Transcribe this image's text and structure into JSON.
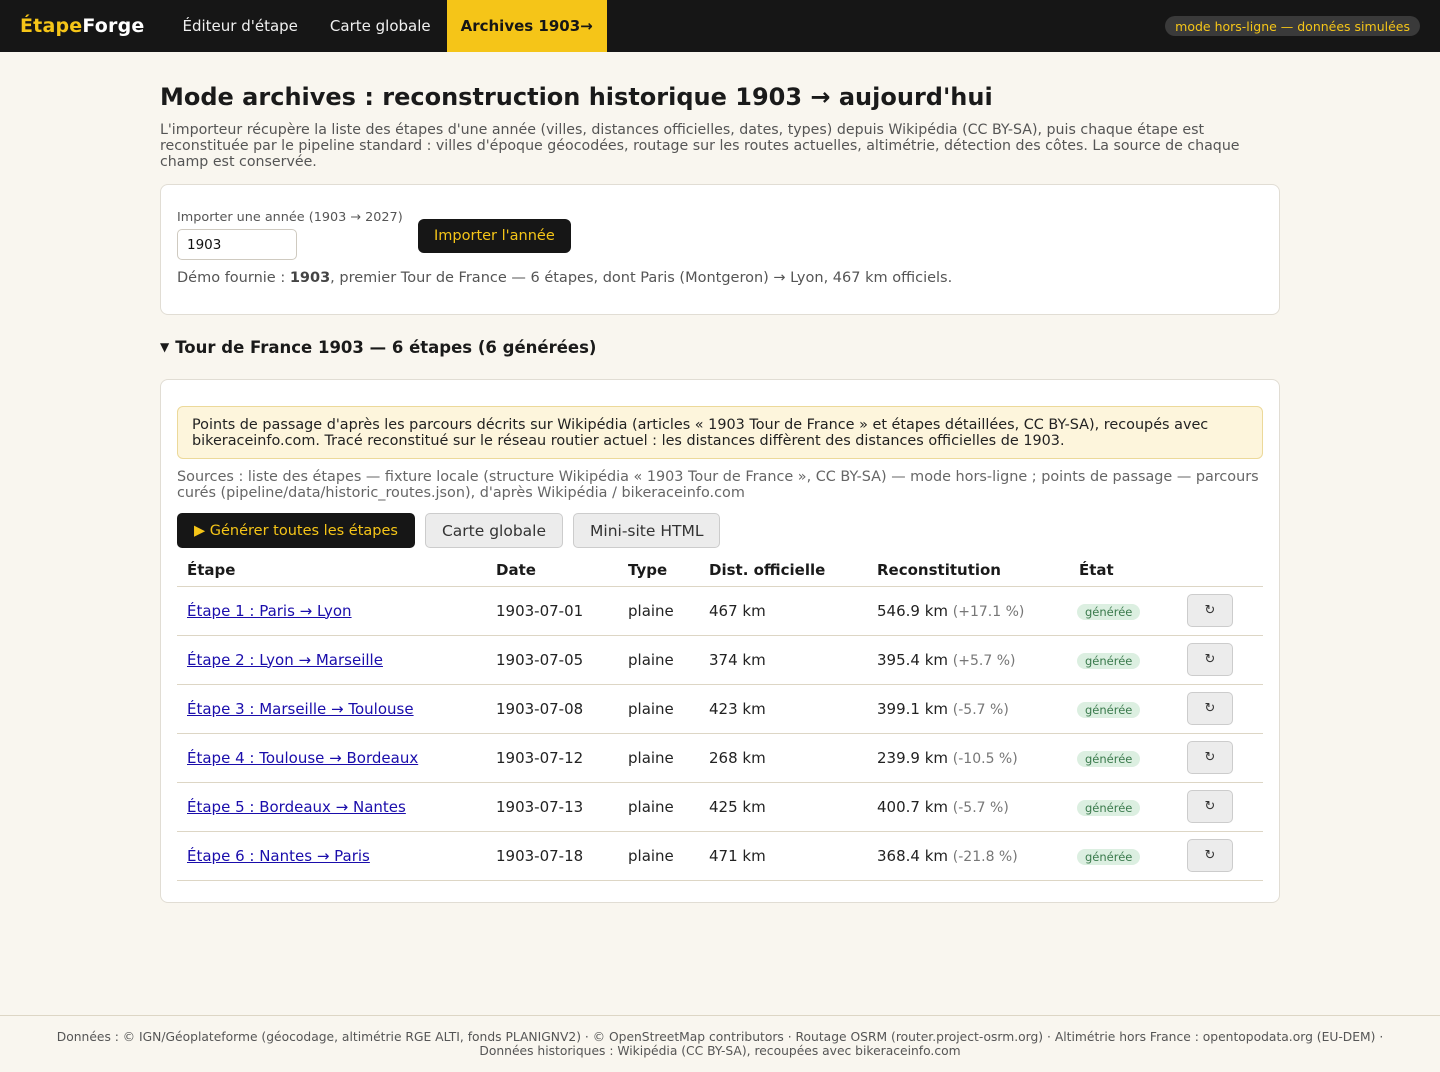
{
  "brand": {
    "part1": "Étape",
    "part2": "Forge"
  },
  "nav": {
    "items": [
      {
        "label": "Éditeur d'étape"
      },
      {
        "label": "Carte globale"
      },
      {
        "label": "Archives 1903→"
      }
    ]
  },
  "status_pill": "mode hors-ligne — données simulées",
  "page": {
    "title": "Mode archives : reconstruction historique 1903 → aujourd'hui",
    "intro": "L'importeur récupère la liste des étapes d'une année (villes, distances officielles, dates, types) depuis Wikipédia (CC BY-SA), puis chaque étape est reconstituée par le pipeline standard : villes d'époque géocodées, routage sur les routes actuelles, altimétrie, détection des côtes. La source de chaque champ est conservée."
  },
  "import": {
    "label": "Importer une année (1903 → 2027)",
    "value": "1903",
    "button": "Importer l'année",
    "demo_prefix": "Démo fournie : ",
    "demo_year": "1903",
    "demo_suffix": ", premier Tour de France — 6 étapes, dont Paris (Montgeron) → Lyon, 467 km officiels."
  },
  "tour": {
    "summary": "Tour de France 1903 — 6 étapes (6 générées)",
    "notice": "Points de passage d'après les parcours décrits sur Wikipédia (articles « 1903 Tour de France » et étapes détaillées, CC BY-SA), recoupés avec bikeraceinfo.com. Tracé reconstitué sur le réseau routier actuel : les distances diffèrent des distances officielles de 1903.",
    "sources": "Sources : liste des étapes — fixture locale (structure Wikipédia « 1903 Tour de France », CC BY-SA) — mode hors-ligne ; points de passage — parcours curés (pipeline/data/historic_routes.json), d'après Wikipédia / bikeraceinfo.com",
    "buttons": {
      "generate_all": "▶ Générer toutes les étapes",
      "global_map": "Carte globale",
      "mini_site": "Mini-site HTML"
    },
    "columns": [
      "Étape",
      "Date",
      "Type",
      "Dist. officielle",
      "Reconstitution",
      "État",
      ""
    ],
    "regen_icon": "↻",
    "stages": [
      {
        "name": "Étape 1 : Paris → Lyon",
        "date": "1903-07-01",
        "type": "plaine",
        "official": "467 km",
        "recon": "546.9 km",
        "delta": "(+17.1 %)",
        "state": "générée"
      },
      {
        "name": "Étape 2 : Lyon → Marseille",
        "date": "1903-07-05",
        "type": "plaine",
        "official": "374 km",
        "recon": "395.4 km",
        "delta": "(+5.7 %)",
        "state": "générée"
      },
      {
        "name": "Étape 3 : Marseille → Toulouse",
        "date": "1903-07-08",
        "type": "plaine",
        "official": "423 km",
        "recon": "399.1 km",
        "delta": "(-5.7 %)",
        "state": "générée"
      },
      {
        "name": "Étape 4 : Toulouse → Bordeaux",
        "date": "1903-07-12",
        "type": "plaine",
        "official": "268 km",
        "recon": "239.9 km",
        "delta": "(-10.5 %)",
        "state": "générée"
      },
      {
        "name": "Étape 5 : Bordeaux → Nantes",
        "date": "1903-07-13",
        "type": "plaine",
        "official": "425 km",
        "recon": "400.7 km",
        "delta": "(-5.7 %)",
        "state": "générée"
      },
      {
        "name": "Étape 6 : Nantes → Paris",
        "date": "1903-07-18",
        "type": "plaine",
        "official": "471 km",
        "recon": "368.4 km",
        "delta": "(-21.8 %)",
        "state": "générée"
      }
    ]
  },
  "footer": "Données : © IGN/Géoplateforme (géocodage, altimétrie RGE ALTI, fonds PLANIGNV2) · © OpenStreetMap contributors · Routage OSRM (router.project-osrm.org) · Altimétrie hors France : opentopodata.org (EU-DEM) · Données historiques : Wikipédia (CC BY-SA), recoupées avec bikeraceinfo.com",
  "colors": {
    "accent": "#f5c518",
    "topbar": "#161616",
    "background": "#f9f6ef",
    "link": "#1a0dab"
  }
}
